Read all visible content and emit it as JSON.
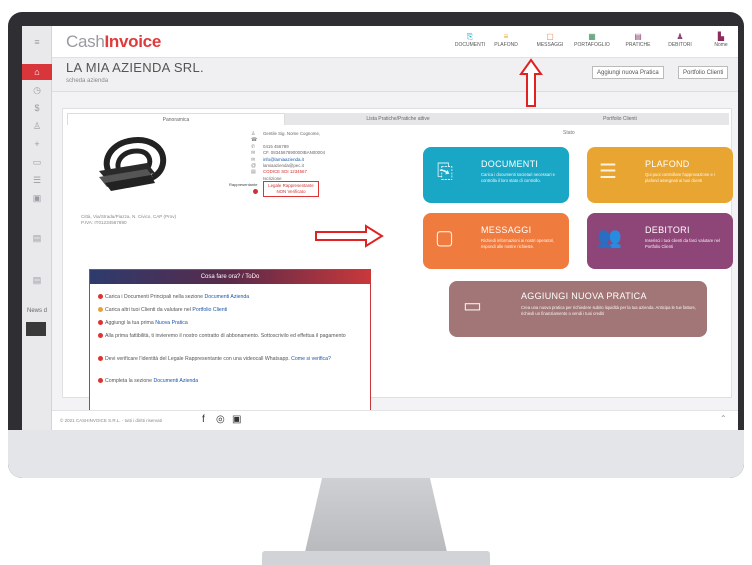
{
  "app": {
    "brand_light": "Cash",
    "brand_bold": "Invoice",
    "copyright": "© 2021 CASHINVOICE S.R.L. - tutti i diritti riservati"
  },
  "nav": [
    {
      "label": "DOCUMENTI",
      "icon": "file-icon"
    },
    {
      "label": "PLAFOND",
      "icon": "list-icon"
    },
    {
      "label": "MESSAGGI",
      "icon": "chat-icon"
    },
    {
      "label": "PORTAFOGLIO",
      "icon": "wallet-icon"
    },
    {
      "label": "PRATICHE",
      "icon": "stack-icon"
    },
    {
      "label": "DEBITORI",
      "icon": "users-icon"
    }
  ],
  "user": {
    "label": "Nome"
  },
  "header": {
    "company": "LA MIA AZIENDA SRL.",
    "subtitle": "scheda azienda",
    "btn_new": "Aggiungi nuova Pratica",
    "btn_clients": "Portfolio Clienti"
  },
  "tabs": [
    "Panoramica",
    "Lista Pratiche/Pratiche attive",
    "Portfolio Clienti"
  ],
  "company_info": {
    "lines": [
      "Gentile Sig. Nome Cognome,",
      "",
      "0415 456789",
      "CF. 0834567890000IBAN00004",
      "info@lamiaazienda.it",
      "lamiaazienda@pec.it",
      "CODICE SDI 1234567",
      "Iscrizione"
    ],
    "legal_label": "Rappresentante",
    "legal_text": "Legale Rappresentante NON Verificato",
    "address": "Città, Via/Strada/Piazza, N. Civico, CAP (Prov)",
    "piva": "P.IVA: IT01234567890"
  },
  "todo": {
    "title": "Cosa fare ora? / ToDo",
    "items": [
      {
        "text": "Carica i Documenti Principali nella sezione",
        "link": "Documenti Azienda",
        "color": "red"
      },
      {
        "text": "Carica altri tuoi Clienti da valutare nel",
        "link": "Portfolio Clienti",
        "color": "yellow"
      },
      {
        "text": "Aggiungi la tua prima",
        "link": "Nuova Pratica",
        "color": "red"
      },
      {
        "text": "Alla prima fattibilità, ti invieremo il nostro contratto di abbonamento. Sottoscrivilo ed effettua il pagamento",
        "link": "",
        "color": "red"
      },
      {
        "text": "Devi verificare l'identità del Legale Rappresentante con una videocall Whatsapp.",
        "link": "Come si verifica?",
        "color": "red"
      },
      {
        "text": "Completa la sezione",
        "link": "Documenti Azienda",
        "color": "red"
      }
    ]
  },
  "status_label": "Stato",
  "tiles": [
    {
      "title": "DOCUMENTI",
      "desc": "Carica i documenti societari necessari e controlla il loro stato di controllo.",
      "color": "#1aa7c6"
    },
    {
      "title": "PLAFOND",
      "desc": "Qui puoi controllare l'approvazione e i plafond assegnati ai tuoi clienti",
      "color": "#e8a531"
    },
    {
      "title": "MESSAGGI",
      "desc": "Richiedi informazioni ai nostri operatori, rispondi alle nostre richieste.",
      "color": "#ef7b3f"
    },
    {
      "title": "DEBITORI",
      "desc": "Inserisci i tuoi clienti da farci valutare nel Portfolio Clienti",
      "color": "#8e4577"
    },
    {
      "title": "AGGIUNGI NUOVA PRATICA",
      "desc": "Crea una nuova pratica per richiedere subito liquidità per la tua azienda. Anticipa le tue fatture, richiedi un finanziamento o vendi i tuoi crediti",
      "color": "#a27676"
    }
  ],
  "sidebar": {
    "news": "News d"
  }
}
